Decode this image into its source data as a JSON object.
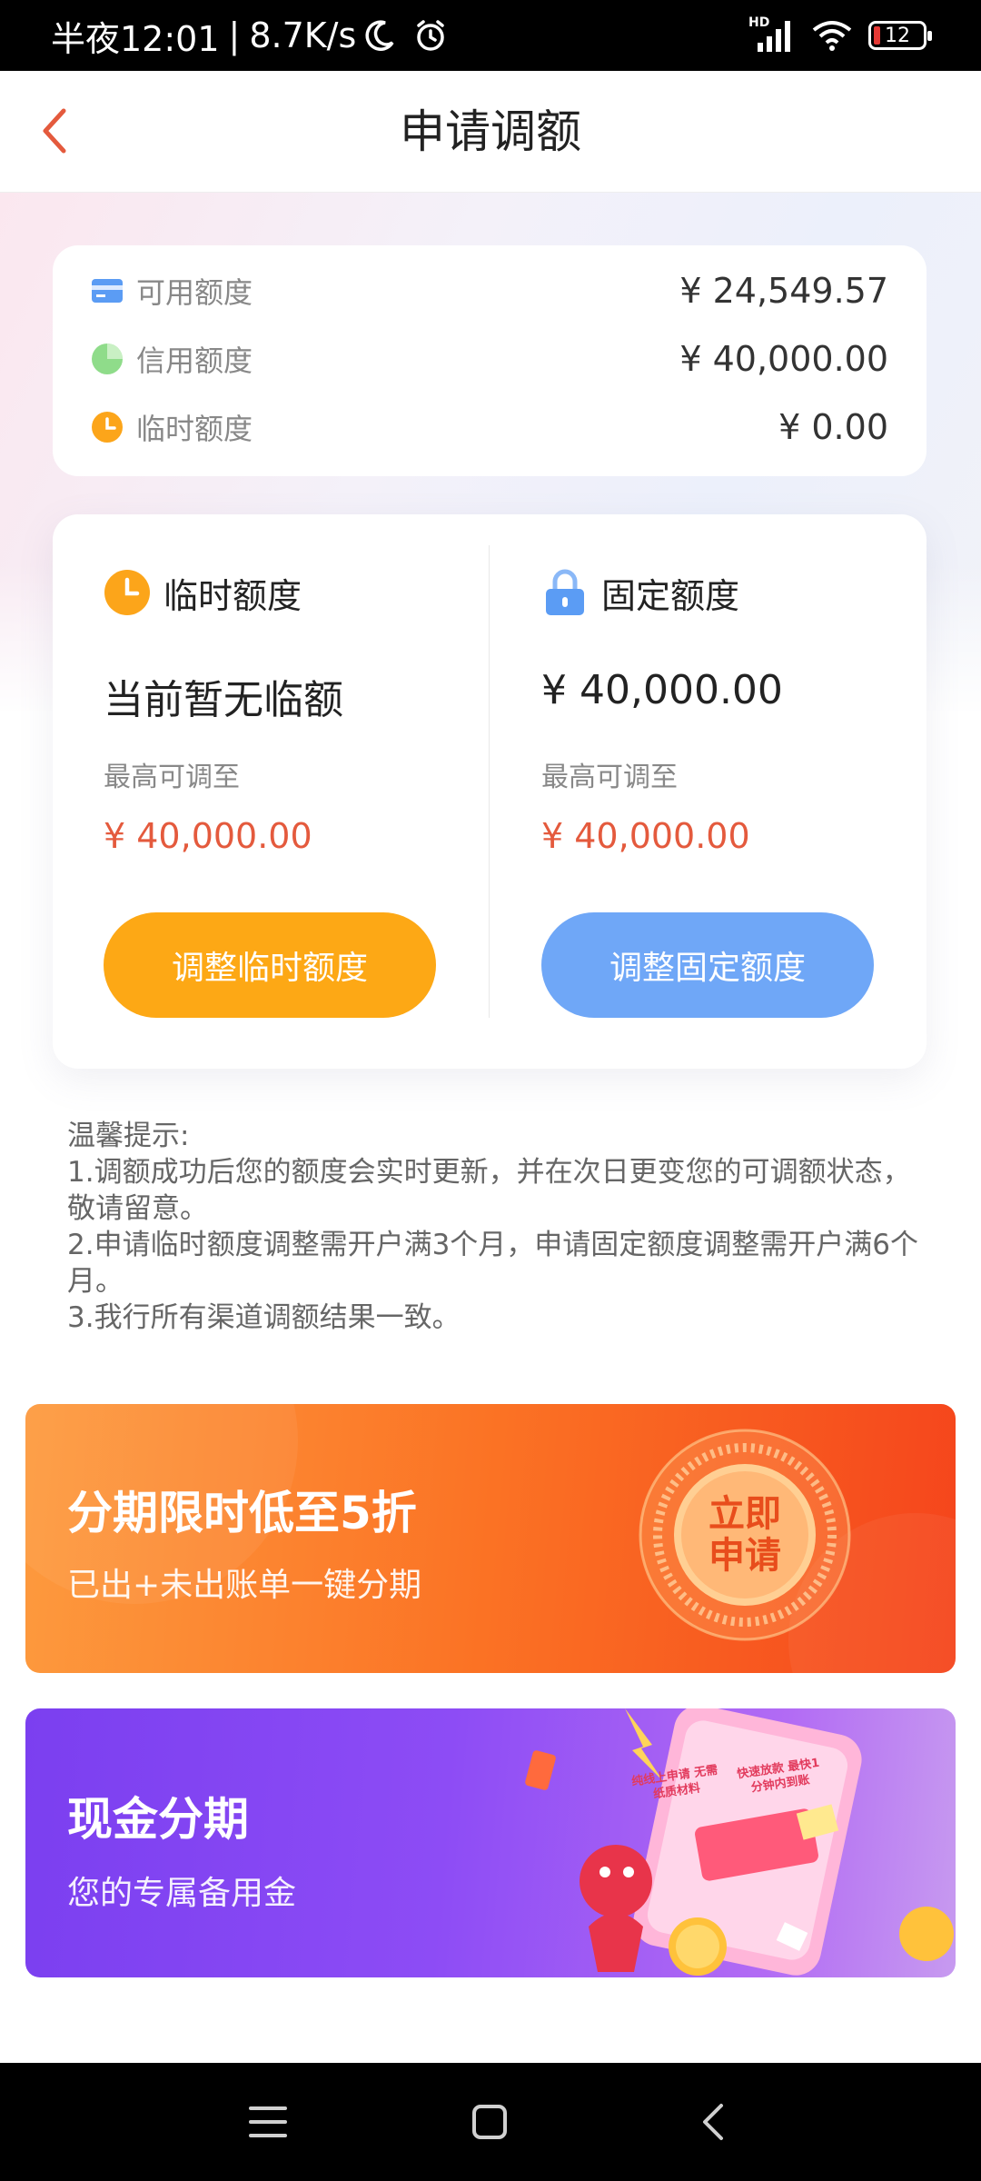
{
  "status_bar": {
    "time": "半夜12:01",
    "speed": "8.7K/s",
    "battery": "12",
    "network_tag": "HD"
  },
  "header": {
    "title": "申请调额"
  },
  "credit_summary": [
    {
      "icon": "card-icon",
      "label": "可用额度",
      "value": "¥ 24,549.57"
    },
    {
      "icon": "pie-chart-icon",
      "label": "信用额度",
      "value": "¥ 40,000.00"
    },
    {
      "icon": "clock-icon",
      "label": "临时额度",
      "value": "¥ 0.00"
    }
  ],
  "temporary": {
    "title": "临时额度",
    "current": "当前暂无临额",
    "max_label": "最高可调至",
    "max_value": "¥ 40,000.00",
    "button": "调整临时额度"
  },
  "fixed": {
    "title": "固定额度",
    "current": "¥ 40,000.00",
    "max_label": "最高可调至",
    "max_value": "¥ 40,000.00",
    "button": "调整固定额度"
  },
  "tips": {
    "heading": "温馨提示:",
    "items": [
      "1.调额成功后您的额度会实时更新，并在次日更变您的可调额状态，敬请留意。",
      "2.申请临时额度调整需开户满3个月，申请固定额度调整需开户满6个月。",
      "3.我行所有渠道调额结果一致。"
    ]
  },
  "banners": {
    "installment": {
      "title": "分期限时低至5折",
      "subtitle": "已出+未出账单一键分期",
      "badge": "立即申请"
    },
    "cash": {
      "title": "现金分期",
      "subtitle": "您的专属备用金",
      "tag1": "纯线上申请 无需纸质材料",
      "tag2": "快速放款 最快1分钟内到账"
    }
  },
  "colors": {
    "accent_red": "#e45a3d",
    "button_orange": "#fda815",
    "button_blue": "#6fa7f7"
  }
}
